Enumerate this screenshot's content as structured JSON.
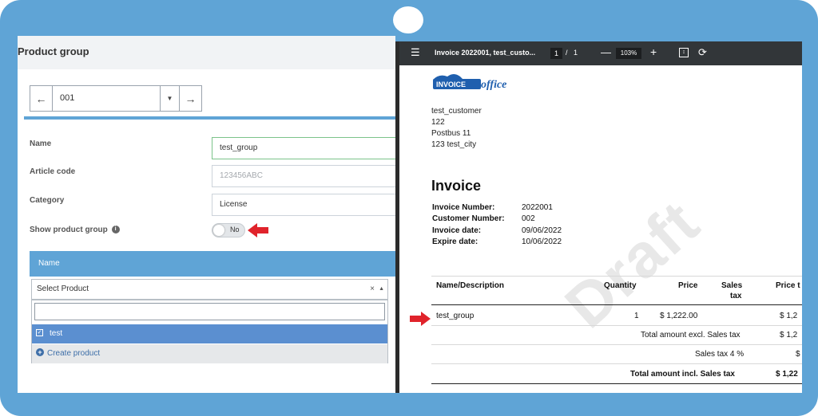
{
  "left_panel": {
    "title": "Product group",
    "record_nav": {
      "prev_icon": "arrow-left-icon",
      "value": "001",
      "dropdown_icon": "caret-down-icon",
      "next_icon": "arrow-right-icon"
    },
    "fields": {
      "name_label": "Name",
      "name_value": "test_group",
      "article_code_label": "Article code",
      "article_code_value": "123456ABC",
      "category_label": "Category",
      "category_value": "License",
      "show_group_label": "Show product group",
      "show_group_toggle": "No"
    },
    "table": {
      "header": "Name",
      "select_placeholder": "Select Product",
      "clear_icon": "×",
      "options": [
        {
          "label": "test",
          "checked": true
        }
      ],
      "create_label": "Create product"
    }
  },
  "pdf_viewer": {
    "toolbar": {
      "title": "Invoice 2022001, test_custo...",
      "page_current": "1",
      "page_sep": "/",
      "page_total": "1",
      "zoom": "103%"
    },
    "logo": {
      "text_part1": "INVOICE",
      "text_part2": "office"
    },
    "address": [
      "test_customer",
      "122",
      "Postbus 11",
      "123 test_city"
    ],
    "invoice_title": "Invoice",
    "meta": [
      {
        "label": "Invoice Number:",
        "value": "2022001"
      },
      {
        "label": "Customer Number:",
        "value": "002"
      },
      {
        "label": "Invoice date:",
        "value": "09/06/2022"
      },
      {
        "label": "Expire date:",
        "value": "10/06/2022"
      }
    ],
    "table": {
      "columns": [
        "Name/Description",
        "Quantity",
        "Price",
        "Sales",
        "tax",
        "Price t"
      ],
      "rows": [
        {
          "name": "test_group",
          "quantity": "1",
          "price": "$ 1,222.00",
          "total": "$ 1,2"
        }
      ],
      "totals": [
        {
          "label": "Total amount excl. Sales tax",
          "value": "$ 1,2"
        },
        {
          "label": "Sales tax 4 %",
          "value": "$"
        },
        {
          "label": "Total amount incl. Sales tax",
          "value": "$ 1,22"
        }
      ]
    },
    "watermark": "Draft"
  },
  "colors": {
    "frame": "#5fa4d6",
    "accent_red": "#e0232b",
    "selected_option": "#5b8fd0",
    "toolbar": "#323639"
  }
}
